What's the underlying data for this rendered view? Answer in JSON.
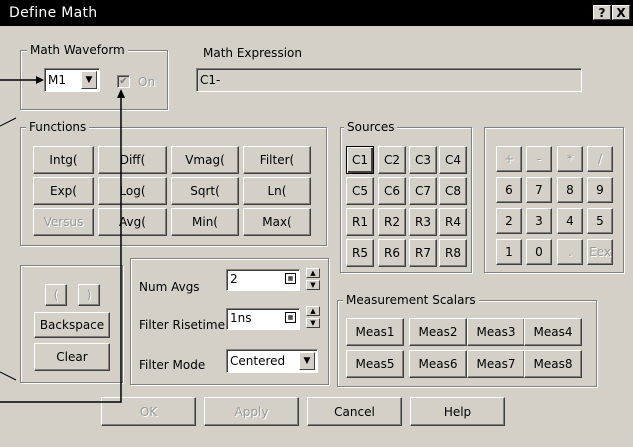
{
  "window": {
    "title": "Define Math",
    "help_btn": "?",
    "close_btn": "X"
  },
  "math_waveform": {
    "label": "Math Waveform",
    "selected": "M1",
    "on_label": "On",
    "on_checked": true
  },
  "math_expression": {
    "label": "Math Expression",
    "value": "C1-"
  },
  "functions": {
    "label": "Functions",
    "rows": [
      [
        "Intg(",
        "Diff(",
        "Vmag(",
        "Filter("
      ],
      [
        "Exp(",
        "Log(",
        "Sqrt(",
        "Ln("
      ],
      [
        "Versus",
        "Avg(",
        "Min(",
        "Max("
      ]
    ]
  },
  "sources": {
    "label": "Sources",
    "rows": [
      [
        "C1",
        "C2",
        "C3",
        "C4"
      ],
      [
        "C5",
        "C6",
        "C7",
        "C8"
      ],
      [
        "R1",
        "R2",
        "R3",
        "R4"
      ],
      [
        "R5",
        "R6",
        "R7",
        "R8"
      ]
    ]
  },
  "keypad": {
    "rows": [
      [
        "+",
        "-",
        "*",
        "/"
      ],
      [
        "6",
        "7",
        "8",
        "9"
      ],
      [
        "2",
        "3",
        "4",
        "5"
      ],
      [
        "1",
        "0",
        ".",
        "Eex"
      ]
    ]
  },
  "edit": {
    "open_paren": "(",
    "close_paren": ")",
    "backspace": "Backspace",
    "clear": "Clear"
  },
  "settings": {
    "num_avgs_label": "Num Avgs",
    "num_avgs_value": "2",
    "filter_risetime_label": "Filter Risetime",
    "filter_risetime_value": "1ns",
    "filter_mode_label": "Filter Mode",
    "filter_mode_value": "Centered"
  },
  "measurement_scalars": {
    "label": "Measurement Scalars",
    "rows": [
      [
        "Meas1",
        "Meas2",
        "Meas3",
        "Meas4"
      ],
      [
        "Meas5",
        "Meas6",
        "Meas7",
        "Meas8"
      ]
    ]
  },
  "footer": {
    "ok": "OK",
    "apply": "Apply",
    "cancel": "Cancel",
    "help": "Help"
  },
  "icons": {
    "dropdown": "chevron-down-icon",
    "spin_up": "up-arrow-icon",
    "spin_down": "down-arrow-icon",
    "calculator": "calculator-icon"
  },
  "colors": {
    "titlebar": "#000000",
    "face": "#d4d0c8",
    "disabled_text": "#9a9a9a"
  }
}
